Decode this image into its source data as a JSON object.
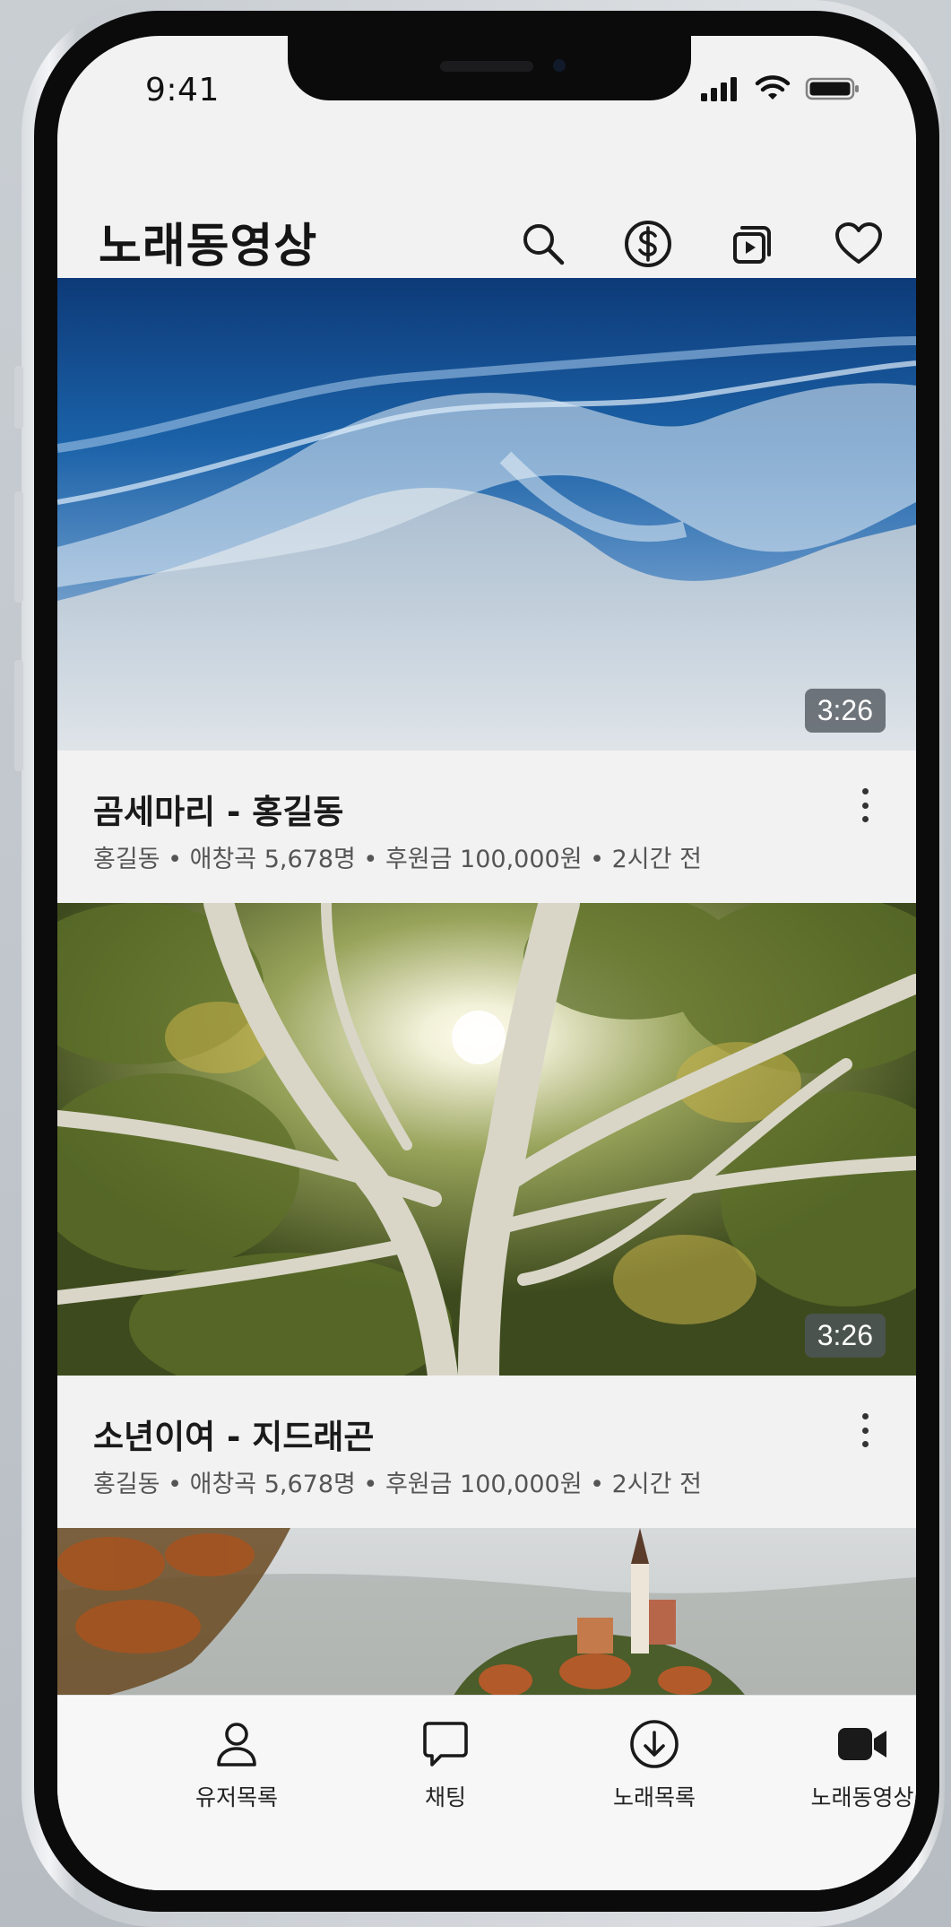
{
  "status_bar": {
    "time": "9:41"
  },
  "header": {
    "title": "노래동영상",
    "icons": [
      "search-icon",
      "dollar-icon",
      "playlist-icon",
      "heart-icon"
    ]
  },
  "videos": [
    {
      "title": "곰세마리 - 홍길동",
      "meta": "홍길동 • 애창곡 5,678명 • 후원금 100,000원 • 2시간 전",
      "duration": "3:26",
      "thumbnail": "ocean-waves-aerial"
    },
    {
      "title": "소년이여 - 지드래곤",
      "meta": "홍길동 • 애창곡 5,678명 • 후원금 100,000원 • 2시간 전",
      "duration": "3:26",
      "thumbnail": "tree-sunlight"
    },
    {
      "thumbnail": "lake-island-church"
    }
  ],
  "tab_bar": [
    {
      "label": "유저목록",
      "icon": "user-icon"
    },
    {
      "label": "채팅",
      "icon": "chat-bubble-icon"
    },
    {
      "label": "노래목록",
      "icon": "download-circle-icon"
    },
    {
      "label": "노래동영상",
      "icon": "video-camera-icon"
    }
  ]
}
